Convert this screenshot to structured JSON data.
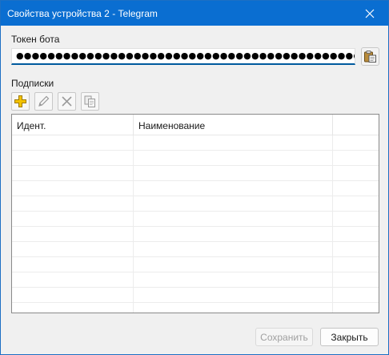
{
  "window": {
    "title": "Свойства устройства 2 - Telegram"
  },
  "token": {
    "label": "Токен бота",
    "value": "●●●●●●●●●●●●●●●●●●●●●●●●●●●●●●●●●●●●●●●●●●●●●●"
  },
  "subscriptions": {
    "label": "Подписки",
    "toolbar": [
      "plus-icon",
      "pencil-icon",
      "delete-icon",
      "copy-icon"
    ],
    "columns": [
      "Идент.",
      "Наименование",
      ""
    ],
    "rows": 11
  },
  "buttons": {
    "save": "Сохранить",
    "close": "Закрыть"
  },
  "colors": {
    "titlebar": "#0a6ed1",
    "accent": "#005a9e",
    "add_icon": "#f2c200"
  }
}
